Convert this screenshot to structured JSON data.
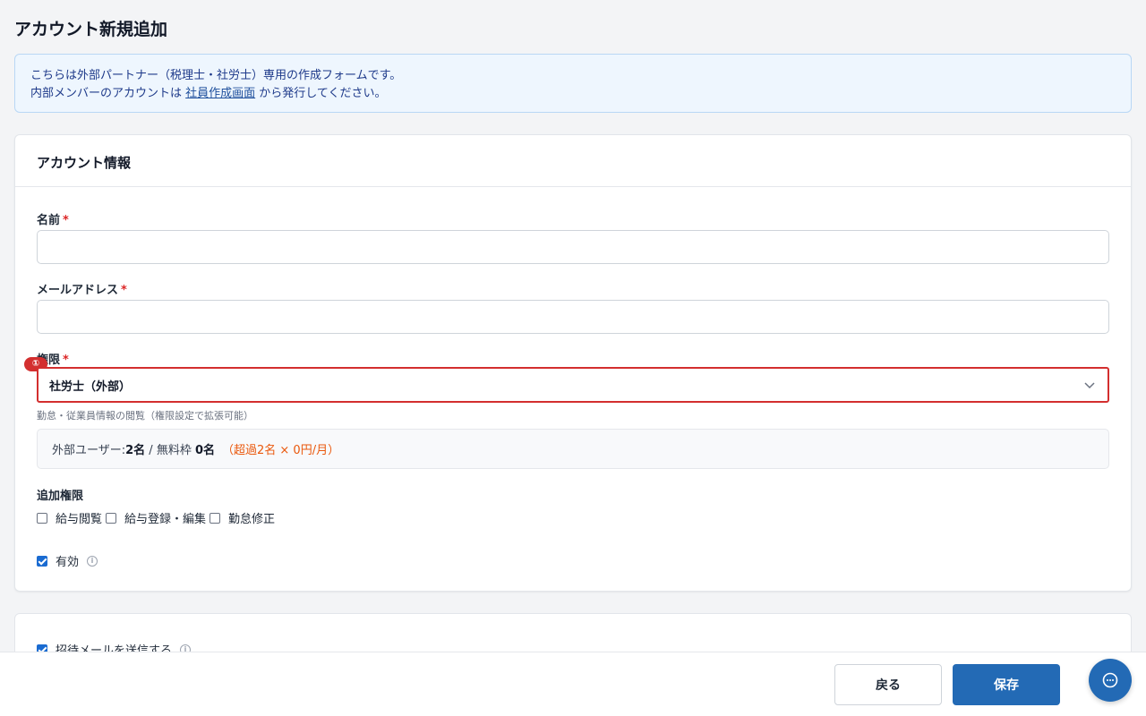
{
  "page": {
    "title": "アカウント新規追加"
  },
  "notice": {
    "line1": "こちらは外部パートナー（税理士・社労士）専用の作成フォームです。",
    "line2_prefix": "内部メンバーのアカウントは ",
    "line2_link": "社員作成画面",
    "line2_suffix": " から発行してください。"
  },
  "account_card": {
    "title": "アカウント情報",
    "name_label": "名前",
    "email_label": "メールアドレス",
    "required_mark": "*",
    "role_label": "権限",
    "role_selected": "社労士（外部）",
    "role_hint": "勤怠・従業員情報の閲覧（権限設定で拡張可能）",
    "badge": "①",
    "usage": {
      "prefix": "外部ユーザー: ",
      "count": "2名",
      "sep": " / 無料枠 ",
      "free": "0名",
      "over": "（超過2名 × 0円/月）"
    },
    "extra_label": "追加権限",
    "extra_permissions": [
      {
        "label": "給与閲覧",
        "checked": false
      },
      {
        "label": "給与登録・編集",
        "checked": false
      },
      {
        "label": "勤怠修正",
        "checked": false
      }
    ],
    "active_label": "有効",
    "active_checked": true,
    "info_glyph": "i"
  },
  "invite_card": {
    "invite_label": "招待メールを送信する",
    "invite_checked": true
  },
  "footer": {
    "back_label": "戻る",
    "save_label": "保存"
  },
  "colors": {
    "primary": "#236ab5",
    "error": "#d32f2f",
    "warning": "#ea580c"
  },
  "icons": {
    "select": "chevron-down-icon",
    "chat": "chat-bubble-icon",
    "info": "info-icon"
  }
}
